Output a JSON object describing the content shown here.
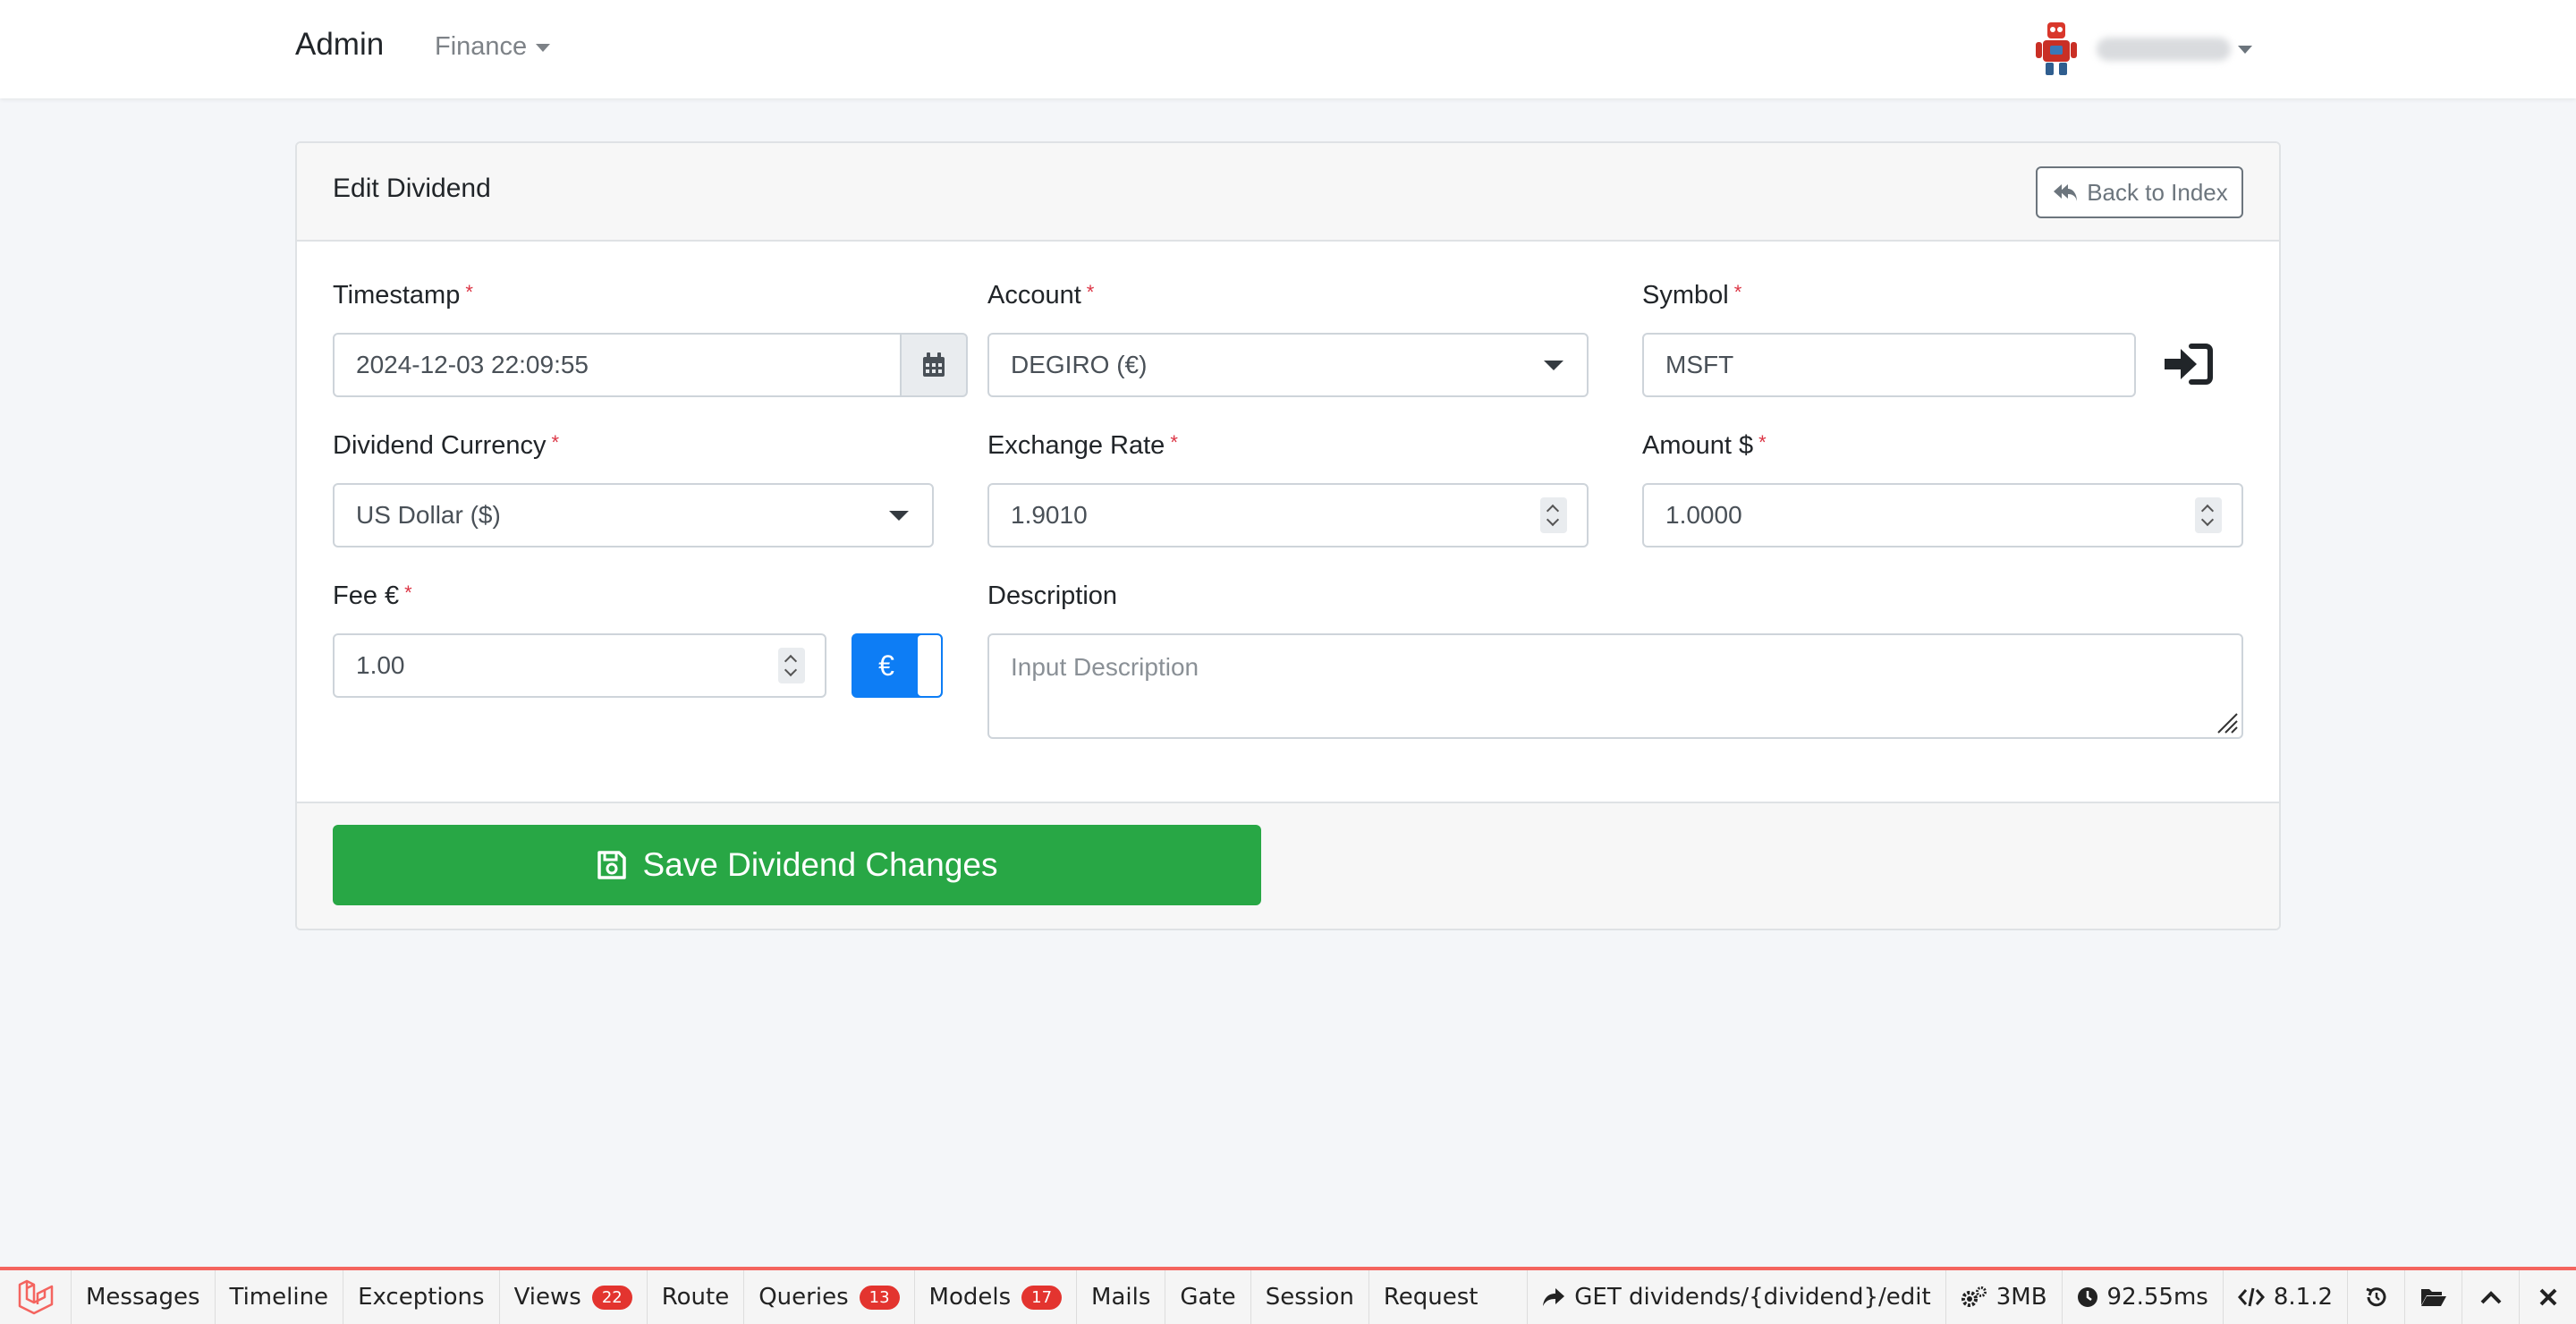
{
  "navbar": {
    "brand": "Admin",
    "menu_finance": "Finance"
  },
  "card": {
    "title": "Edit Dividend",
    "back_button": "Back to Index"
  },
  "form": {
    "timestamp": {
      "label": "Timestamp",
      "required": "*",
      "value": "2024-12-03 22:09:55"
    },
    "account": {
      "label": "Account",
      "required": "*",
      "value": "DEGIRO (€)"
    },
    "symbol": {
      "label": "Symbol",
      "required": "*",
      "value": "MSFT"
    },
    "dividend_currency": {
      "label": "Dividend Currency",
      "required": "*",
      "value": "US Dollar ($)"
    },
    "exchange_rate": {
      "label": "Exchange Rate",
      "required": "*",
      "value": "1.9010"
    },
    "amount": {
      "label": "Amount $",
      "required": "*",
      "value": "1.0000"
    },
    "fee": {
      "label": "Fee €",
      "required": "*",
      "value": "1.00",
      "toggle_label": "€"
    },
    "description": {
      "label": "Description",
      "placeholder": "Input Description"
    }
  },
  "footer": {
    "save_button": "Save Dividend Changes"
  },
  "debugbar": {
    "tabs": {
      "messages": "Messages",
      "timeline": "Timeline",
      "exceptions": "Exceptions",
      "views": "Views",
      "views_count": "22",
      "route": "Route",
      "queries": "Queries",
      "queries_count": "13",
      "models": "Models",
      "models_count": "17",
      "mails": "Mails",
      "gate": "Gate",
      "session": "Session",
      "request": "Request"
    },
    "route_info": "GET dividends/{dividend}/edit",
    "memory": "3MB",
    "duration": "92.55ms",
    "php_version": "8.1.2"
  },
  "colors": {
    "primary": "#0d7df5",
    "success": "#28a745",
    "danger": "#dc3545",
    "debugbar_accent": "#f4645f",
    "badge": "#e3342f"
  }
}
